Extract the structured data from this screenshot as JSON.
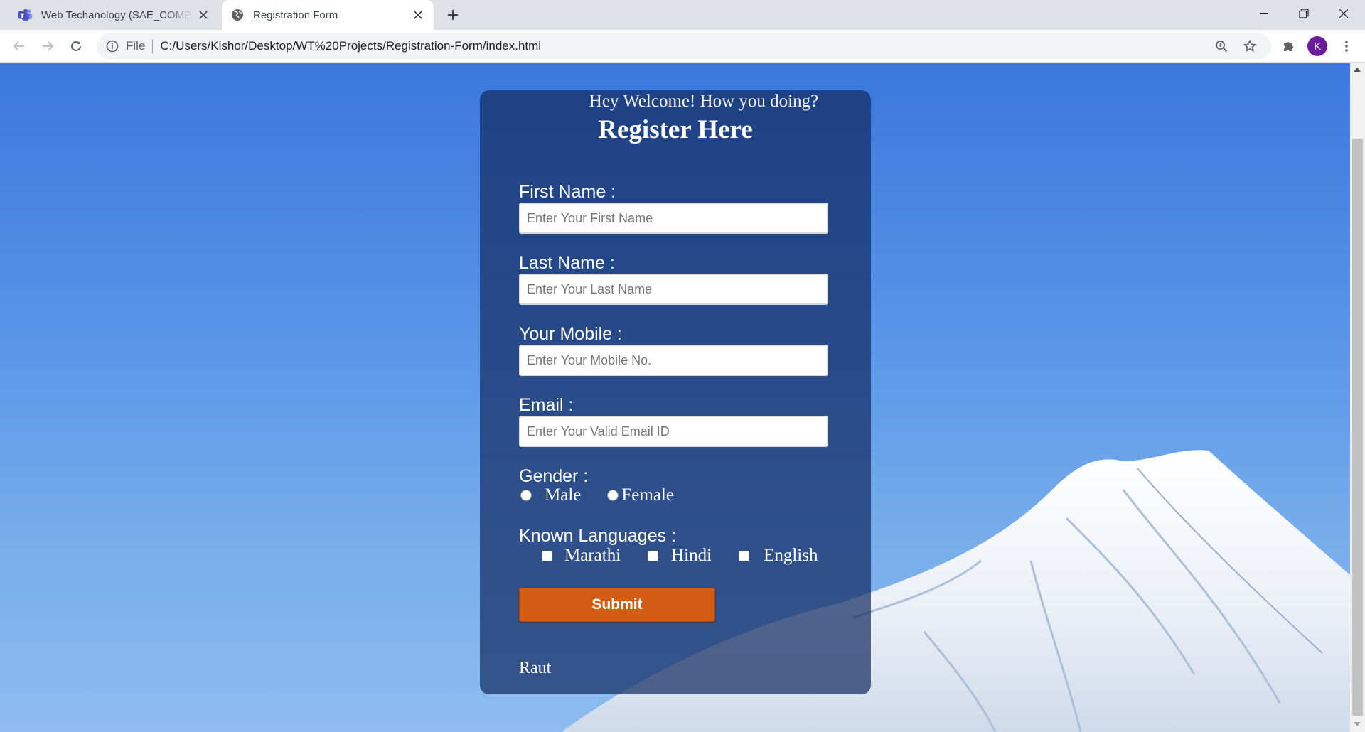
{
  "browser": {
    "tabs": [
      {
        "title": "Web Techanology (SAE_COMP_TE",
        "icon": "teams-icon"
      },
      {
        "title": "Registration Form",
        "icon": "globe-icon"
      }
    ],
    "address": {
      "scheme_label": "File",
      "url": "C:/Users/Kishor/Desktop/WT%20Projects/Registration-Form/index.html"
    },
    "profile_initial": "K"
  },
  "form": {
    "welcome": "Hey Welcome! How you doing?",
    "heading": "Register Here",
    "first_name": {
      "label": "First Name :",
      "placeholder": "Enter Your First Name",
      "value": ""
    },
    "last_name": {
      "label": "Last Name :",
      "placeholder": "Enter Your Last Name",
      "value": ""
    },
    "mobile": {
      "label": "Your Mobile :",
      "placeholder": "Enter Your Mobile No.",
      "value": ""
    },
    "email": {
      "label": "Email :",
      "placeholder": "Enter Your Valid Email ID",
      "value": ""
    },
    "gender": {
      "label": "Gender :",
      "options": [
        "Male",
        "Female"
      ]
    },
    "languages": {
      "label": "Known Languages :",
      "options": [
        "Marathi",
        "Hindi",
        "English"
      ]
    },
    "submit_label": "Submit",
    "footer": "Raut"
  },
  "colors": {
    "card_background": "#142d64",
    "submit_button": "#d25c14",
    "sky": "#3a78dd"
  }
}
